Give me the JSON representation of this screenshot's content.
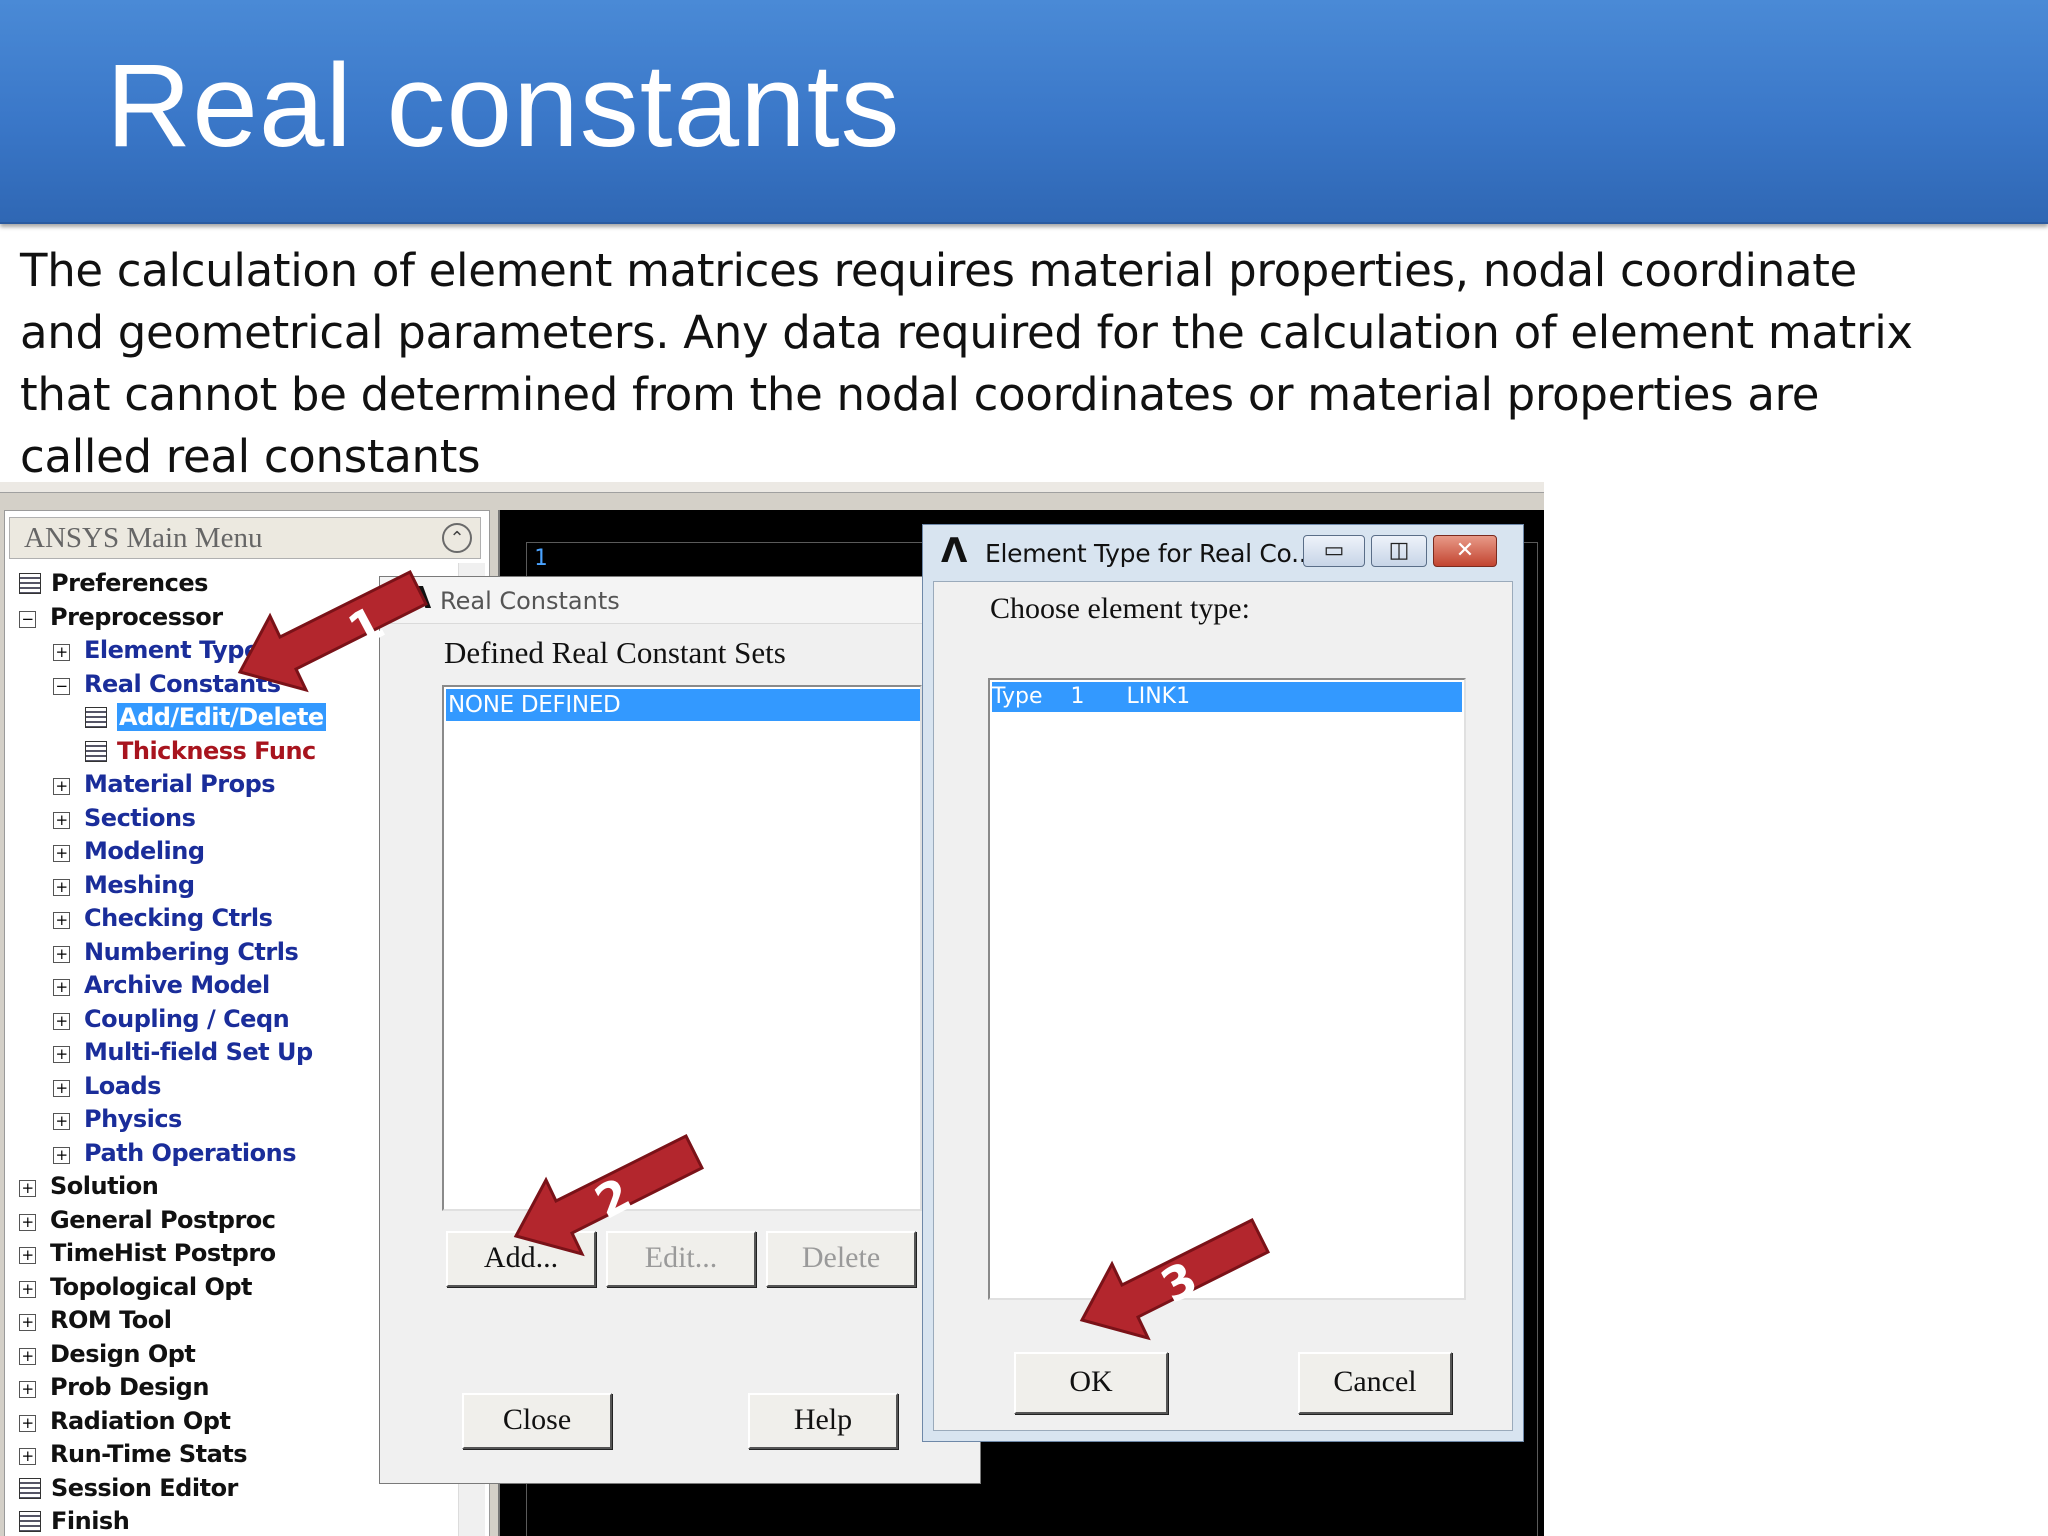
{
  "slide": {
    "title": "Real constants",
    "body": "The calculation of element matrices requires material properties, nodal coordinate and geometrical parameters. Any data  required for the calculation of element matrix that cannot be determined from the nodal coordinates or material properties are called real constants"
  },
  "main_menu": {
    "title": "ANSYS Main Menu",
    "items": [
      {
        "label": "Preferences"
      },
      {
        "label": "Preprocessor"
      },
      {
        "label": "Element Type"
      },
      {
        "label": "Real Constants"
      },
      {
        "label": "Add/Edit/Delete"
      },
      {
        "label": "Thickness Func"
      },
      {
        "label": "Material Props"
      },
      {
        "label": "Sections"
      },
      {
        "label": "Modeling"
      },
      {
        "label": "Meshing"
      },
      {
        "label": "Checking Ctrls"
      },
      {
        "label": "Numbering Ctrls"
      },
      {
        "label": "Archive Model"
      },
      {
        "label": "Coupling / Ceqn"
      },
      {
        "label": "Multi-field Set Up"
      },
      {
        "label": "Loads"
      },
      {
        "label": "Physics"
      },
      {
        "label": "Path Operations"
      },
      {
        "label": "Solution"
      },
      {
        "label": "General Postproc"
      },
      {
        "label": "TimeHist Postpro"
      },
      {
        "label": "Topological Opt"
      },
      {
        "label": "ROM Tool"
      },
      {
        "label": "Design Opt"
      },
      {
        "label": "Prob Design"
      },
      {
        "label": "Radiation Opt"
      },
      {
        "label": "Run-Time Stats"
      },
      {
        "label": "Session Editor"
      },
      {
        "label": "Finish"
      }
    ]
  },
  "graphics": {
    "window_number": "1"
  },
  "real_constants_dialog": {
    "title": "Real Constants",
    "heading": "Defined Real Constant Sets",
    "list": [
      "NONE DEFINED"
    ],
    "add_label": "Add...",
    "edit_label": "Edit...",
    "delete_label": "Delete",
    "close_label": "Close",
    "help_label": "Help"
  },
  "element_type_dialog": {
    "title": "Element Type for Real Co...",
    "prompt": "Choose element type:",
    "list": [
      "Type    1      LINK1"
    ],
    "ok_label": "OK",
    "cancel_label": "Cancel"
  },
  "annotations": {
    "arrow1": "1",
    "arrow2": "2",
    "arrow3": "3",
    "arrow_color": "#b3262d"
  }
}
